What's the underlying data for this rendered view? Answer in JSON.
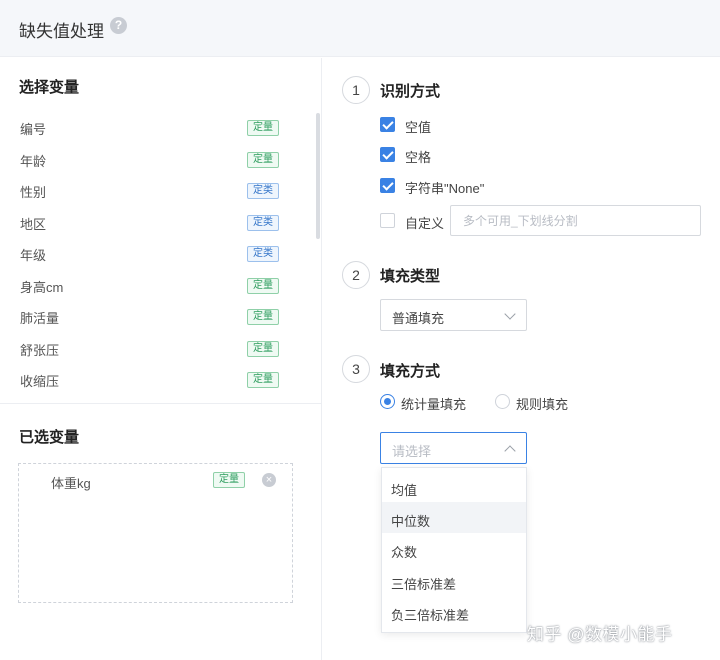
{
  "header": {
    "title": "缺失值处理",
    "help_icon": "question-circle-icon"
  },
  "left_panel": {
    "select_title": "选择变量",
    "variables": [
      {
        "name": "编号",
        "tag": "定量"
      },
      {
        "name": "年龄",
        "tag": "定量"
      },
      {
        "name": "性别",
        "tag": "定类"
      },
      {
        "name": "地区",
        "tag": "定类"
      },
      {
        "name": "年级",
        "tag": "定类"
      },
      {
        "name": "身高cm",
        "tag": "定量"
      },
      {
        "name": "肺活量",
        "tag": "定量"
      },
      {
        "name": "舒张压",
        "tag": "定量"
      },
      {
        "name": "收缩压",
        "tag": "定量"
      }
    ],
    "selected_title": "已选变量",
    "selected": [
      {
        "name": "体重kg",
        "tag": "定量",
        "remove_icon": "close-circle-icon"
      }
    ]
  },
  "step1": {
    "num": "1",
    "title": "识别方式",
    "options": [
      {
        "label": "空值",
        "checked": true
      },
      {
        "label": "空格",
        "checked": true
      },
      {
        "label": "字符串\"None\"",
        "checked": true
      },
      {
        "label": "自定义",
        "checked": false
      }
    ],
    "custom_placeholder": "多个可用_下划线分割"
  },
  "step2": {
    "num": "2",
    "title": "填充类型",
    "select_value": "普通填充"
  },
  "step3": {
    "num": "3",
    "title": "填充方式",
    "radios": [
      {
        "label": "统计量填充",
        "selected": true
      },
      {
        "label": "规则填充",
        "selected": false
      }
    ],
    "select_placeholder": "请选择",
    "dropdown_options": [
      "均值",
      "中位数",
      "众数",
      "三倍标准差",
      "负三倍标准差"
    ],
    "hovered_option": "中位数"
  },
  "watermark": "知乎 @数模小能手",
  "colors": {
    "accent": "#3a82e4",
    "quant_tag": "#2e9d5f",
    "qual_tag": "#3576c9"
  }
}
